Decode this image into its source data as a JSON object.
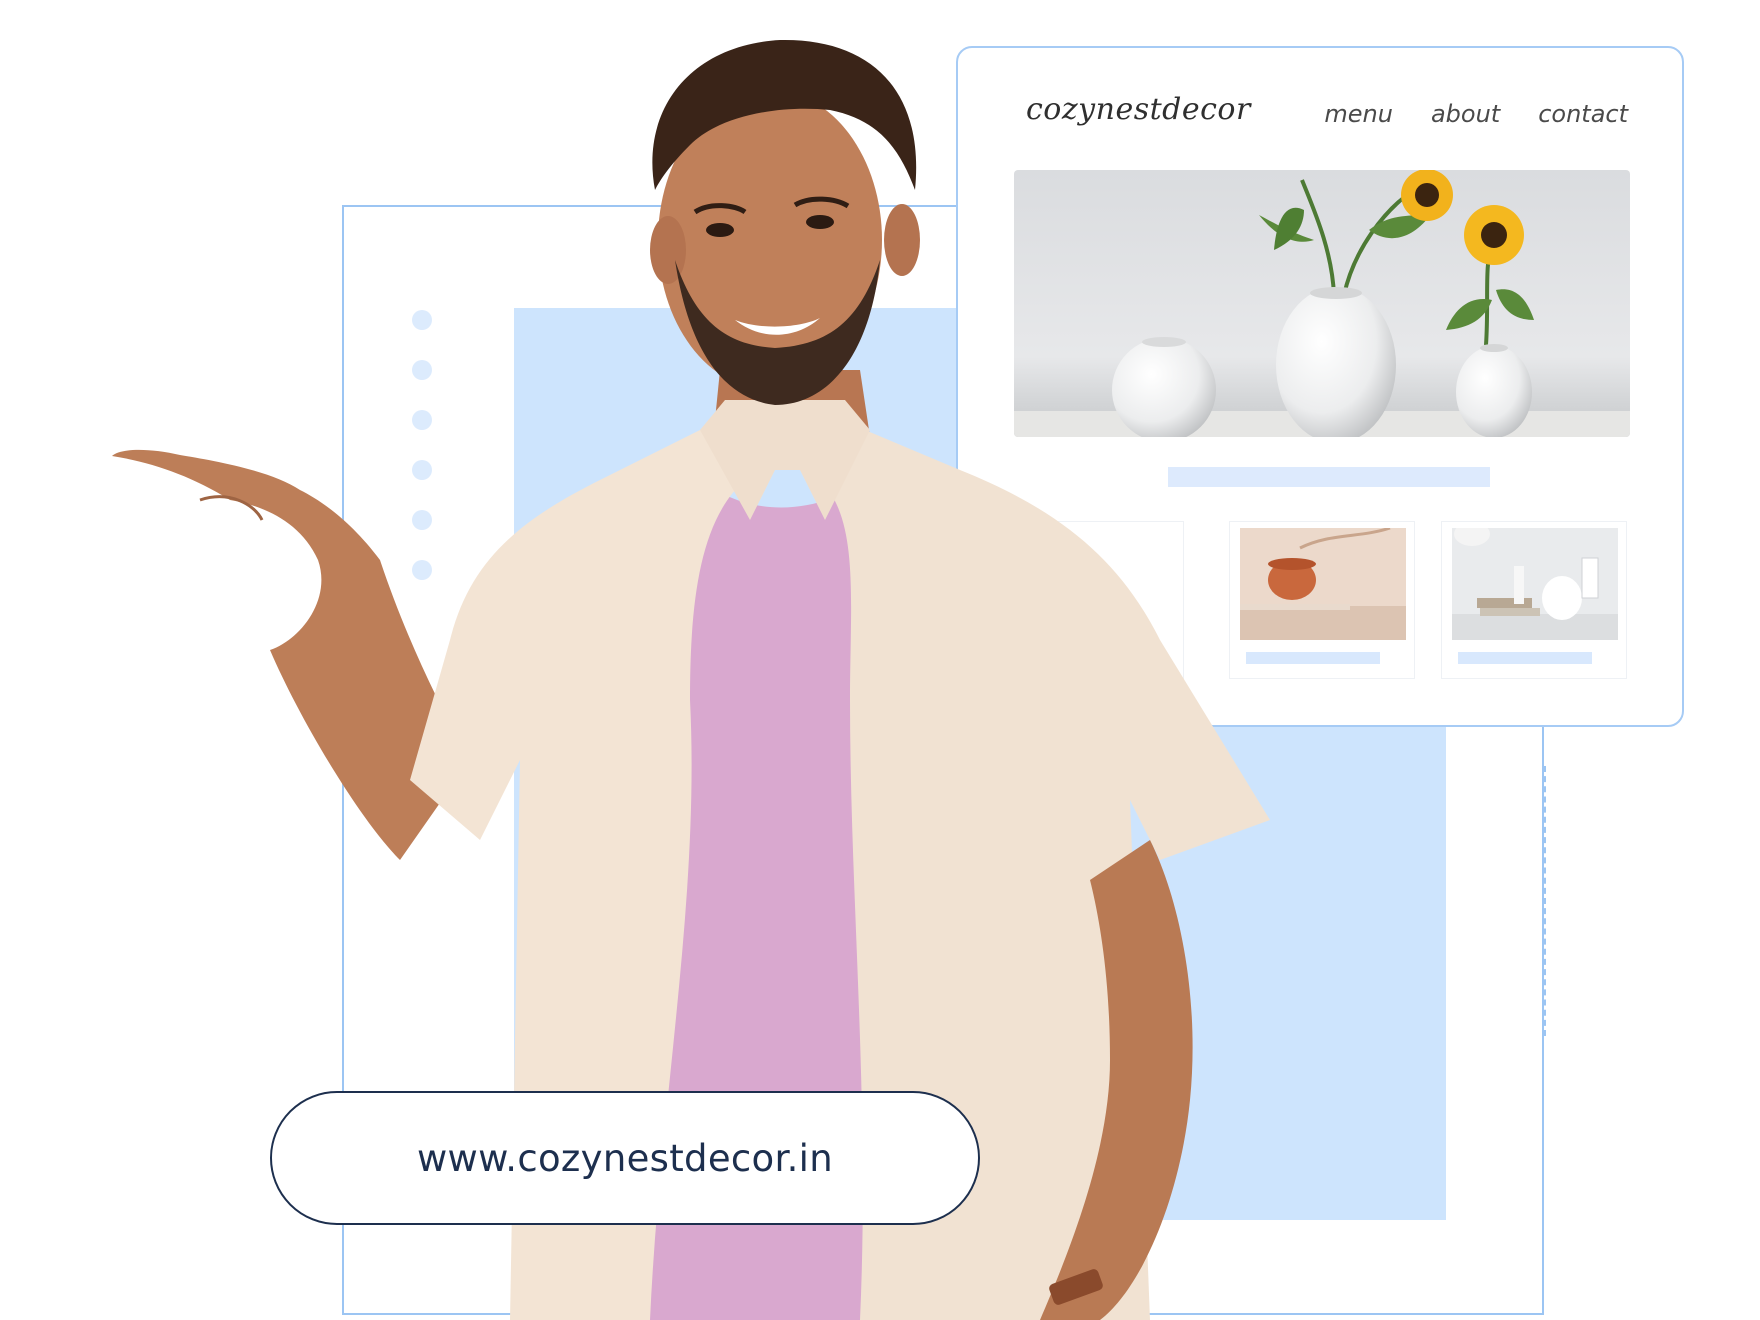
{
  "site": {
    "logo": "cozynestdecor",
    "nav": [
      "menu",
      "about",
      "contact"
    ]
  },
  "url": "www.cozynestdecor.in",
  "colors": {
    "frame_outline": "#9cc5f3",
    "blue_block": "#cde4fd",
    "placeholder_bar": "#ddeafd",
    "pill_border": "#1d2f4e",
    "shirt": "#f3e6d8",
    "tshirt": "#d9a8cf",
    "skin": "#b97a54"
  },
  "icons": {
    "hero_image": "white-vases-with-sunflowers",
    "thumb_1": "copper-bowl-on-table",
    "thumb_2": "white-vases-and-books"
  }
}
